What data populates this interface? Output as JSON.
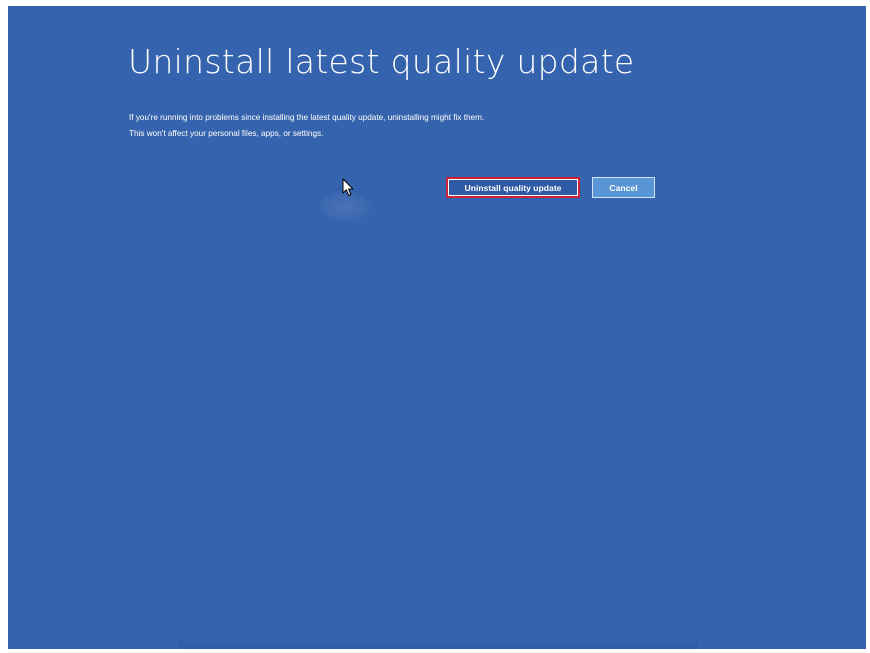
{
  "page": {
    "title": "Uninstall latest quality update",
    "description_line1": "If you're running into problems since installing the latest quality update, uninstalling might fix them.",
    "description_line2": "This won't affect your personal files, apps, or settings."
  },
  "buttons": {
    "uninstall_label": "Uninstall quality update",
    "cancel_label": "Cancel"
  },
  "colors": {
    "background": "#3563ad",
    "primary_button": "#2f5ba6",
    "focus_outline": "#c9243a",
    "secondary_button": "#5a95d6",
    "text": "#ffffff"
  },
  "icons": {
    "cursor": "mouse-pointer-icon"
  }
}
